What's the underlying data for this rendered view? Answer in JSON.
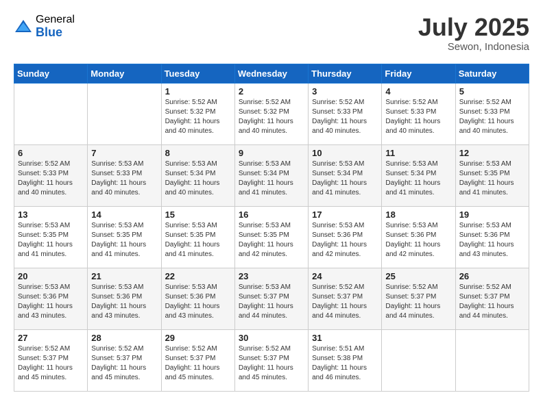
{
  "logo": {
    "general": "General",
    "blue": "Blue"
  },
  "title": "July 2025",
  "location": "Sewon, Indonesia",
  "days_of_week": [
    "Sunday",
    "Monday",
    "Tuesday",
    "Wednesday",
    "Thursday",
    "Friday",
    "Saturday"
  ],
  "weeks": [
    [
      {
        "day": "",
        "info": ""
      },
      {
        "day": "",
        "info": ""
      },
      {
        "day": "1",
        "info": "Sunrise: 5:52 AM\nSunset: 5:32 PM\nDaylight: 11 hours and 40 minutes."
      },
      {
        "day": "2",
        "info": "Sunrise: 5:52 AM\nSunset: 5:32 PM\nDaylight: 11 hours and 40 minutes."
      },
      {
        "day": "3",
        "info": "Sunrise: 5:52 AM\nSunset: 5:33 PM\nDaylight: 11 hours and 40 minutes."
      },
      {
        "day": "4",
        "info": "Sunrise: 5:52 AM\nSunset: 5:33 PM\nDaylight: 11 hours and 40 minutes."
      },
      {
        "day": "5",
        "info": "Sunrise: 5:52 AM\nSunset: 5:33 PM\nDaylight: 11 hours and 40 minutes."
      }
    ],
    [
      {
        "day": "6",
        "info": "Sunrise: 5:52 AM\nSunset: 5:33 PM\nDaylight: 11 hours and 40 minutes."
      },
      {
        "day": "7",
        "info": "Sunrise: 5:53 AM\nSunset: 5:33 PM\nDaylight: 11 hours and 40 minutes."
      },
      {
        "day": "8",
        "info": "Sunrise: 5:53 AM\nSunset: 5:34 PM\nDaylight: 11 hours and 40 minutes."
      },
      {
        "day": "9",
        "info": "Sunrise: 5:53 AM\nSunset: 5:34 PM\nDaylight: 11 hours and 41 minutes."
      },
      {
        "day": "10",
        "info": "Sunrise: 5:53 AM\nSunset: 5:34 PM\nDaylight: 11 hours and 41 minutes."
      },
      {
        "day": "11",
        "info": "Sunrise: 5:53 AM\nSunset: 5:34 PM\nDaylight: 11 hours and 41 minutes."
      },
      {
        "day": "12",
        "info": "Sunrise: 5:53 AM\nSunset: 5:35 PM\nDaylight: 11 hours and 41 minutes."
      }
    ],
    [
      {
        "day": "13",
        "info": "Sunrise: 5:53 AM\nSunset: 5:35 PM\nDaylight: 11 hours and 41 minutes."
      },
      {
        "day": "14",
        "info": "Sunrise: 5:53 AM\nSunset: 5:35 PM\nDaylight: 11 hours and 41 minutes."
      },
      {
        "day": "15",
        "info": "Sunrise: 5:53 AM\nSunset: 5:35 PM\nDaylight: 11 hours and 41 minutes."
      },
      {
        "day": "16",
        "info": "Sunrise: 5:53 AM\nSunset: 5:35 PM\nDaylight: 11 hours and 42 minutes."
      },
      {
        "day": "17",
        "info": "Sunrise: 5:53 AM\nSunset: 5:36 PM\nDaylight: 11 hours and 42 minutes."
      },
      {
        "day": "18",
        "info": "Sunrise: 5:53 AM\nSunset: 5:36 PM\nDaylight: 11 hours and 42 minutes."
      },
      {
        "day": "19",
        "info": "Sunrise: 5:53 AM\nSunset: 5:36 PM\nDaylight: 11 hours and 43 minutes."
      }
    ],
    [
      {
        "day": "20",
        "info": "Sunrise: 5:53 AM\nSunset: 5:36 PM\nDaylight: 11 hours and 43 minutes."
      },
      {
        "day": "21",
        "info": "Sunrise: 5:53 AM\nSunset: 5:36 PM\nDaylight: 11 hours and 43 minutes."
      },
      {
        "day": "22",
        "info": "Sunrise: 5:53 AM\nSunset: 5:36 PM\nDaylight: 11 hours and 43 minutes."
      },
      {
        "day": "23",
        "info": "Sunrise: 5:53 AM\nSunset: 5:37 PM\nDaylight: 11 hours and 44 minutes."
      },
      {
        "day": "24",
        "info": "Sunrise: 5:52 AM\nSunset: 5:37 PM\nDaylight: 11 hours and 44 minutes."
      },
      {
        "day": "25",
        "info": "Sunrise: 5:52 AM\nSunset: 5:37 PM\nDaylight: 11 hours and 44 minutes."
      },
      {
        "day": "26",
        "info": "Sunrise: 5:52 AM\nSunset: 5:37 PM\nDaylight: 11 hours and 44 minutes."
      }
    ],
    [
      {
        "day": "27",
        "info": "Sunrise: 5:52 AM\nSunset: 5:37 PM\nDaylight: 11 hours and 45 minutes."
      },
      {
        "day": "28",
        "info": "Sunrise: 5:52 AM\nSunset: 5:37 PM\nDaylight: 11 hours and 45 minutes."
      },
      {
        "day": "29",
        "info": "Sunrise: 5:52 AM\nSunset: 5:37 PM\nDaylight: 11 hours and 45 minutes."
      },
      {
        "day": "30",
        "info": "Sunrise: 5:52 AM\nSunset: 5:37 PM\nDaylight: 11 hours and 45 minutes."
      },
      {
        "day": "31",
        "info": "Sunrise: 5:51 AM\nSunset: 5:38 PM\nDaylight: 11 hours and 46 minutes."
      },
      {
        "day": "",
        "info": ""
      },
      {
        "day": "",
        "info": ""
      }
    ]
  ]
}
